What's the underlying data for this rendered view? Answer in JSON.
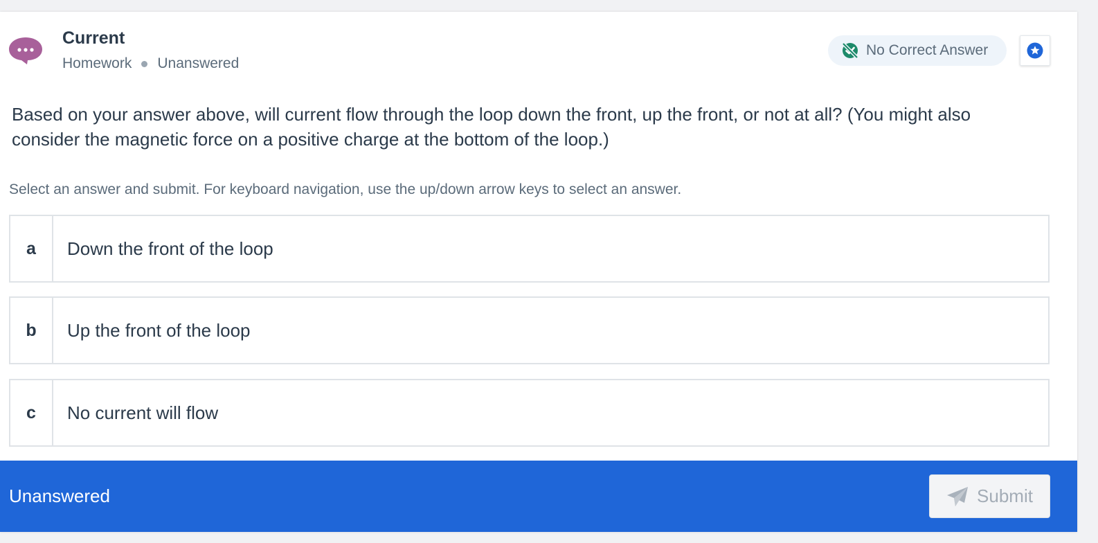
{
  "header": {
    "title": "Current",
    "category": "Homework",
    "status": "Unanswered",
    "badge_label": "No Correct Answer",
    "avatar_icon": "speech-bubble-ellipsis-icon",
    "avatar_color": "#a8609a"
  },
  "question": {
    "text": "Based on your answer above, will current flow through the loop down the front, up the front, or not at all? (You might also consider the magnetic force on a positive charge at the bottom of the loop.)",
    "instructions": "Select an answer and submit. For keyboard navigation, use the up/down arrow keys to select an answer."
  },
  "options": [
    {
      "letter": "a",
      "text": "Down the front of the loop"
    },
    {
      "letter": "b",
      "text": "Up the front of the loop"
    },
    {
      "letter": "c",
      "text": "No current will flow"
    }
  ],
  "footer": {
    "status": "Unanswered",
    "submit_label": "Submit",
    "background_color": "#1f66d8"
  },
  "colors": {
    "accent": "#1f66d8",
    "badge_icon": "#1d8a6a",
    "star_icon": "#1f66d8"
  }
}
